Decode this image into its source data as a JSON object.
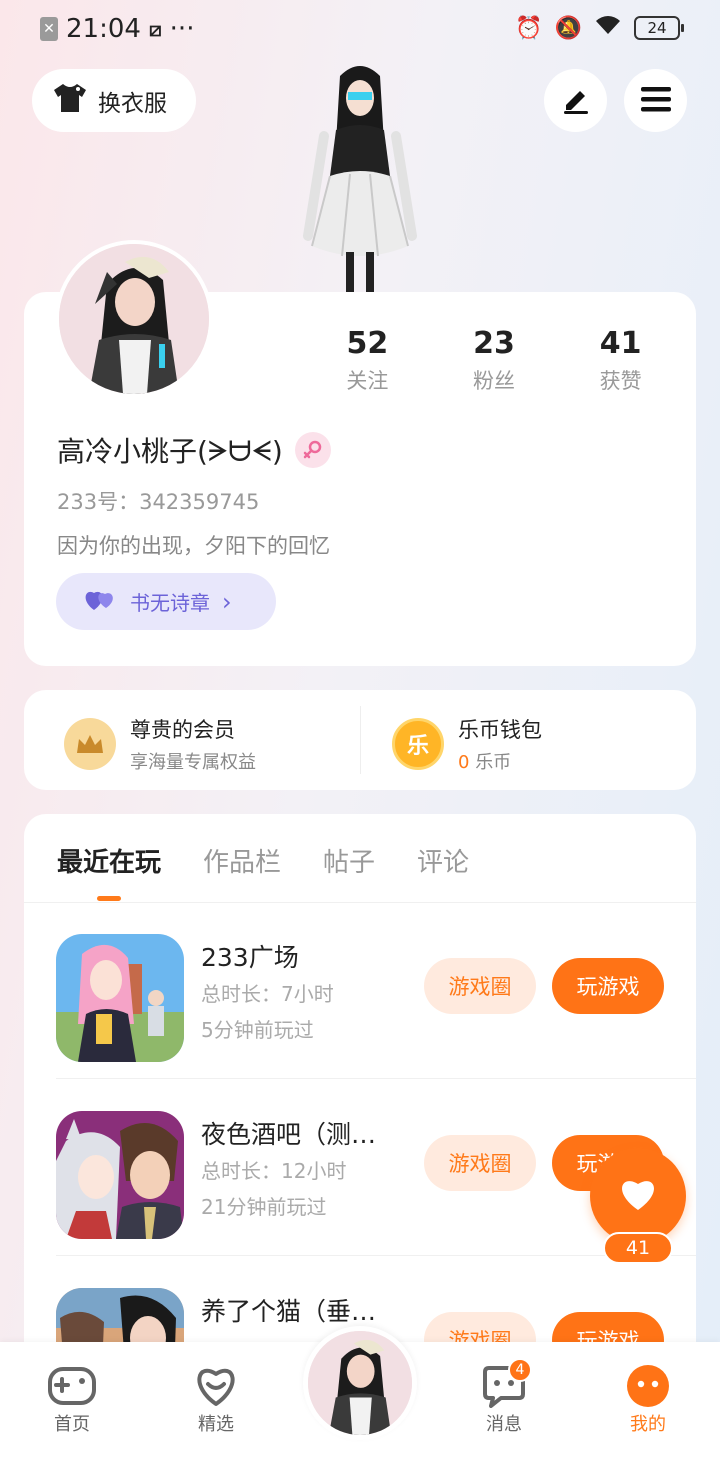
{
  "status_bar": {
    "time": "21:04",
    "more": "···",
    "battery": "24"
  },
  "header": {
    "outfit_label": "换衣服"
  },
  "profile": {
    "stats": [
      {
        "value": "52",
        "label": "关注"
      },
      {
        "value": "23",
        "label": "粉丝"
      },
      {
        "value": "41",
        "label": "获赞"
      }
    ],
    "username": "高冷小桃子(ᗒᗨᗕ)",
    "uid": "233号：342359745",
    "bio": "因为你的出现，夕阳下的回忆",
    "title_badge": "书无诗章"
  },
  "vip": {
    "member_title": "尊贵的会员",
    "member_sub": "享海量专属权益",
    "wallet_title": "乐币钱包",
    "wallet_amount": "0",
    "wallet_unit": "乐币",
    "wallet_icon_char": "乐"
  },
  "tabs": [
    "最近在玩",
    "作品栏",
    "帖子",
    "评论"
  ],
  "games": [
    {
      "name": "233广场",
      "total_time": "总时长：7小时",
      "last_played": "5分钟前玩过"
    },
    {
      "name": "夜色酒吧（测…",
      "total_time": "总时长：12小时",
      "last_played": "21分钟前玩过"
    },
    {
      "name": "养了个猫（垂…",
      "total_time": "",
      "last_played": ""
    }
  ],
  "game_buttons": {
    "circle": "游戏圈",
    "play": "玩游戏"
  },
  "like_fab": {
    "count": "41"
  },
  "bottom_nav": {
    "home": "首页",
    "featured": "精选",
    "messages": "消息",
    "messages_badge": "4",
    "mine": "我的"
  },
  "colors": {
    "accent": "#ff7316",
    "accent_light": "#ffeade",
    "title_pill": "#e8e7fb",
    "title_pill_text": "#6c63d8"
  }
}
